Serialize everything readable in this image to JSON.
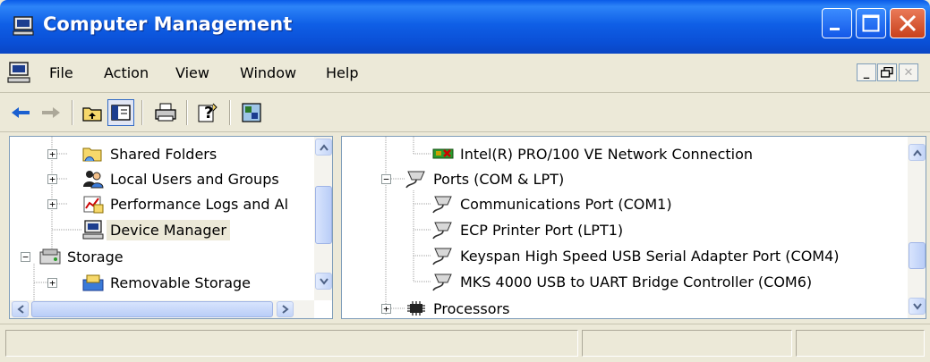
{
  "window": {
    "title": "Computer Management"
  },
  "menu": {
    "items": [
      "File",
      "Action",
      "View",
      "Window",
      "Help"
    ]
  },
  "toolbar": {
    "buttons": [
      {
        "icon": "back-arrow-icon"
      },
      {
        "icon": "forward-arrow-icon"
      },
      {
        "icon": "up-folder-icon"
      },
      {
        "icon": "show-hide-console-tree-icon",
        "pressed": true
      },
      {
        "icon": "print-icon"
      },
      {
        "icon": "help-icon"
      },
      {
        "icon": "properties-icon"
      }
    ]
  },
  "left_tree": {
    "items": [
      {
        "label": "Shared Folders",
        "expander": "+",
        "icon": "shared-folders-icon"
      },
      {
        "label": "Local Users and Groups",
        "expander": "+",
        "icon": "users-icon"
      },
      {
        "label": "Performance Logs and Al",
        "expander": "+",
        "icon": "performance-logs-icon"
      },
      {
        "label": "Device Manager",
        "expander": "",
        "icon": "device-manager-icon",
        "selected": true
      },
      {
        "label": "Storage",
        "expander": "−",
        "icon": "storage-icon"
      },
      {
        "label": "Removable Storage",
        "expander": "+",
        "icon": "removable-storage-icon"
      }
    ]
  },
  "right_tree": {
    "items": [
      {
        "label": "Intel(R) PRO/100 VE Network Connection",
        "icon": "network-adapter-icon"
      },
      {
        "label": "Ports (COM & LPT)",
        "expander": "−",
        "icon": "port-icon"
      },
      {
        "label": "Communications Port (COM1)",
        "icon": "port-icon"
      },
      {
        "label": "ECP Printer Port (LPT1)",
        "icon": "port-icon"
      },
      {
        "label": "Keyspan High Speed USB Serial Adapter Port (COM4)",
        "icon": "port-icon"
      },
      {
        "label": "MKS 4000 USB to UART Bridge Controller (COM6)",
        "icon": "port-icon"
      },
      {
        "label": "Processors",
        "expander": "+",
        "icon": "processor-icon"
      }
    ]
  },
  "colors": {
    "title_bar": "#0a5be8",
    "window_bg": "#ece9d8",
    "close_button": "#d8542c"
  }
}
